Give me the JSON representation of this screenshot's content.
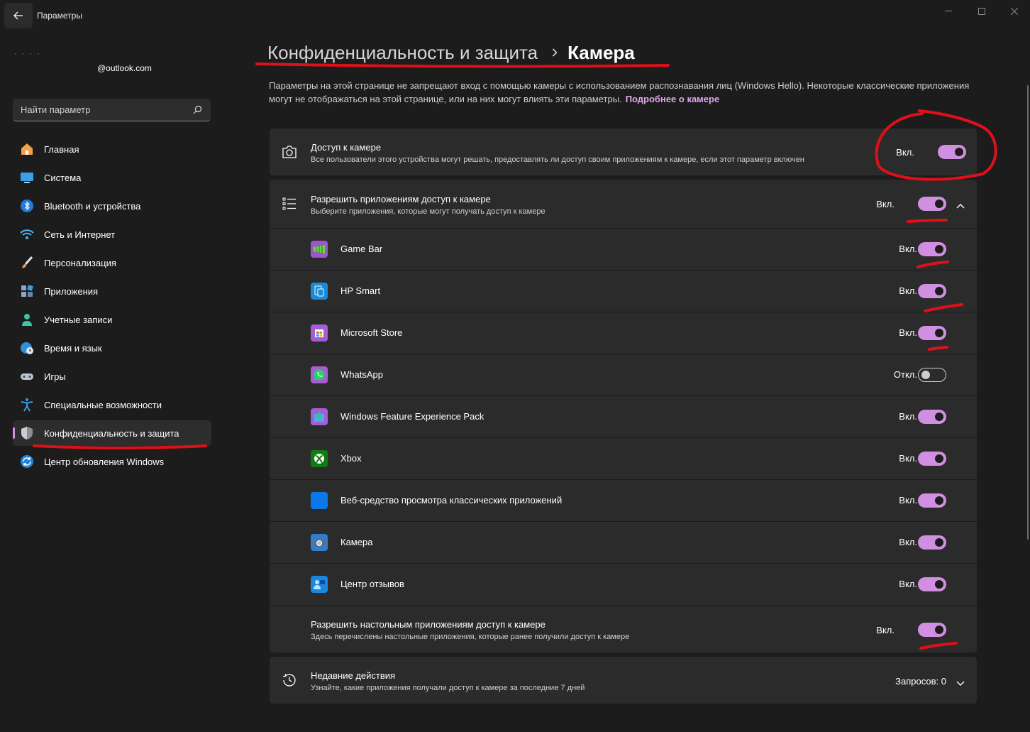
{
  "window": {
    "title": "Параметры"
  },
  "account": {
    "name_masked": "·    ·     ·         ·",
    "email": "@outlook.com"
  },
  "search": {
    "placeholder": "Найти параметр"
  },
  "sidebar": {
    "items": [
      {
        "label": "Главная",
        "icon": "home-icon"
      },
      {
        "label": "Система",
        "icon": "monitor-icon"
      },
      {
        "label": "Bluetooth и устройства",
        "icon": "bluetooth-icon"
      },
      {
        "label": "Сеть и Интернет",
        "icon": "wifi-icon"
      },
      {
        "label": "Персонализация",
        "icon": "brush-icon"
      },
      {
        "label": "Приложения",
        "icon": "apps-icon"
      },
      {
        "label": "Учетные записи",
        "icon": "person-icon"
      },
      {
        "label": "Время и язык",
        "icon": "globe-clock-icon"
      },
      {
        "label": "Игры",
        "icon": "gamepad-icon"
      },
      {
        "label": "Специальные возможности",
        "icon": "accessibility-icon"
      },
      {
        "label": "Конфиденциальность и защита",
        "icon": "shield-icon",
        "active": true
      },
      {
        "label": "Центр обновления Windows",
        "icon": "update-icon"
      }
    ]
  },
  "breadcrumb": {
    "parent": "Конфиденциальность и защита",
    "current": "Камера"
  },
  "description": {
    "text": "Параметры на этой странице не запрещают вход с помощью камеры с использованием распознавания лиц (Windows Hello). Некоторые классические приложения могут не отображаться на этой странице, или на них могут влиять эти параметры.",
    "link": "Подробнее о камере"
  },
  "camera_access": {
    "title": "Доступ к камере",
    "subtitle": "Все пользователи этого устройства могут решать, предоставлять ли доступ своим приложениям к камере, если этот параметр включен",
    "state": "Вкл.",
    "on": true
  },
  "app_access": {
    "title": "Разрешить приложениям доступ к камере",
    "subtitle": "Выберите приложения, которые могут получать доступ к камере",
    "state": "Вкл.",
    "on": true
  },
  "apps": [
    {
      "name": "Game Bar",
      "state": "Вкл.",
      "on": true,
      "icon": "game-bar-icon"
    },
    {
      "name": "HP Smart",
      "state": "Вкл.",
      "on": true,
      "icon": "hp-smart-icon"
    },
    {
      "name": "Microsoft Store",
      "state": "Вкл.",
      "on": true,
      "icon": "microsoft-store-icon"
    },
    {
      "name": "WhatsApp",
      "state": "Откл.",
      "on": false,
      "icon": "whatsapp-icon"
    },
    {
      "name": "Windows Feature Experience Pack",
      "state": "Вкл.",
      "on": true,
      "icon": "feature-pack-icon"
    },
    {
      "name": "Xbox",
      "state": "Вкл.",
      "on": true,
      "icon": "xbox-icon"
    },
    {
      "name": "Веб-средство просмотра классических приложений",
      "state": "Вкл.",
      "on": true,
      "icon": "web-viewer-icon"
    },
    {
      "name": "Камера",
      "state": "Вкл.",
      "on": true,
      "icon": "camera-app-icon"
    },
    {
      "name": "Центр отзывов",
      "state": "Вкл.",
      "on": true,
      "icon": "feedback-hub-icon"
    }
  ],
  "desktop_access": {
    "title": "Разрешить настольным приложениям доступ к камере",
    "subtitle": "Здесь перечислены настольные приложения, которые ранее получили доступ к камере",
    "state": "Вкл.",
    "on": true
  },
  "recent": {
    "title": "Недавние действия",
    "subtitle": "Узнайте, какие приложения получали доступ к камере за последние 7 дней",
    "requests": "Запросов: 0"
  },
  "colors": {
    "accent": "#d08fe0",
    "background": "#1c1c1c",
    "card": "#2b2b2b",
    "annotation": "#e0101a"
  }
}
